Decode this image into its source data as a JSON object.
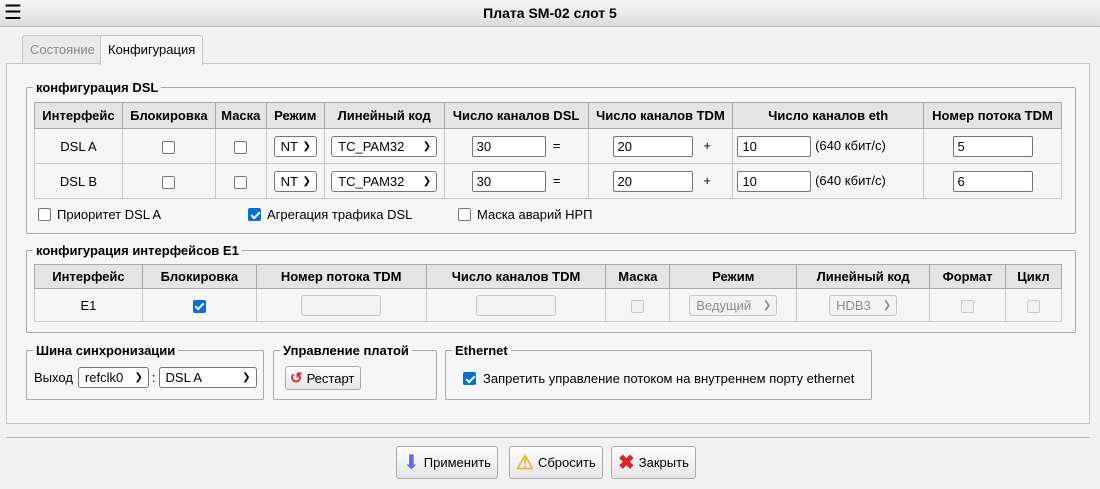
{
  "window": {
    "title": "Плата SM-02 слот 5",
    "menu_icon": "hamburger-icon"
  },
  "tabs": [
    {
      "label": "Состояние",
      "active": false
    },
    {
      "label": "Конфигурация",
      "active": true
    }
  ],
  "dsl": {
    "legend": "конфигурация DSL",
    "headers": [
      "Интерфейс",
      "Блокировка",
      "Маска",
      "Режим",
      "Линейный код",
      "Число каналов DSL",
      "Число каналов TDM",
      "Число каналов eth",
      "Номер потока TDM"
    ],
    "rows": [
      {
        "iface": "DSL A",
        "block": false,
        "mask": false,
        "mode": "NT",
        "code": "TC_PAM32",
        "dsl_ch": "30",
        "eq": "=",
        "tdm_ch": "20",
        "plus": "+",
        "eth_ch": "10",
        "eth_rate": "(640 кбит/с)",
        "tdm_stream": "5"
      },
      {
        "iface": "DSL B",
        "block": false,
        "mask": false,
        "mode": "NT",
        "code": "TC_PAM32",
        "dsl_ch": "30",
        "eq": "=",
        "tdm_ch": "20",
        "plus": "+",
        "eth_ch": "10",
        "eth_rate": "(640 кбит/с)",
        "tdm_stream": "6"
      }
    ],
    "options": [
      {
        "label": "Приоритет DSL A",
        "checked": false
      },
      {
        "label": "Агрегация трафика DSL",
        "checked": true
      },
      {
        "label": "Маска аварий НРП",
        "checked": false
      }
    ]
  },
  "e1": {
    "legend": "конфигурация интерфейсов E1",
    "headers": [
      "Интерфейс",
      "Блокировка",
      "Номер потока TDM",
      "Число каналов TDM",
      "Маска",
      "Режим",
      "Линейный код",
      "Формат",
      "Цикл"
    ],
    "row": {
      "iface": "E1",
      "block": true,
      "tdm_stream": "",
      "tdm_ch": "",
      "mask": false,
      "mode": "Ведущий",
      "code": "HDB3",
      "format": false,
      "cycle": false
    }
  },
  "sync": {
    "legend": "Шина синхронизации",
    "label": "Выход",
    "clock": "refclk0",
    "colon": ":",
    "source": "DSL A"
  },
  "board": {
    "legend": "Управление платой",
    "restart_label": "Рестарт"
  },
  "ethernet": {
    "legend": "Ethernet",
    "label": "Запретить управление потоком на внутреннем порту ethernet",
    "checked": true
  },
  "buttons": {
    "apply": "Применить",
    "reset": "Сбросить",
    "close": "Закрыть"
  },
  "colors": {
    "check_blue": "#0a6fd4",
    "close_red": "#d9262b",
    "reset_yellow": "#f5c400"
  }
}
